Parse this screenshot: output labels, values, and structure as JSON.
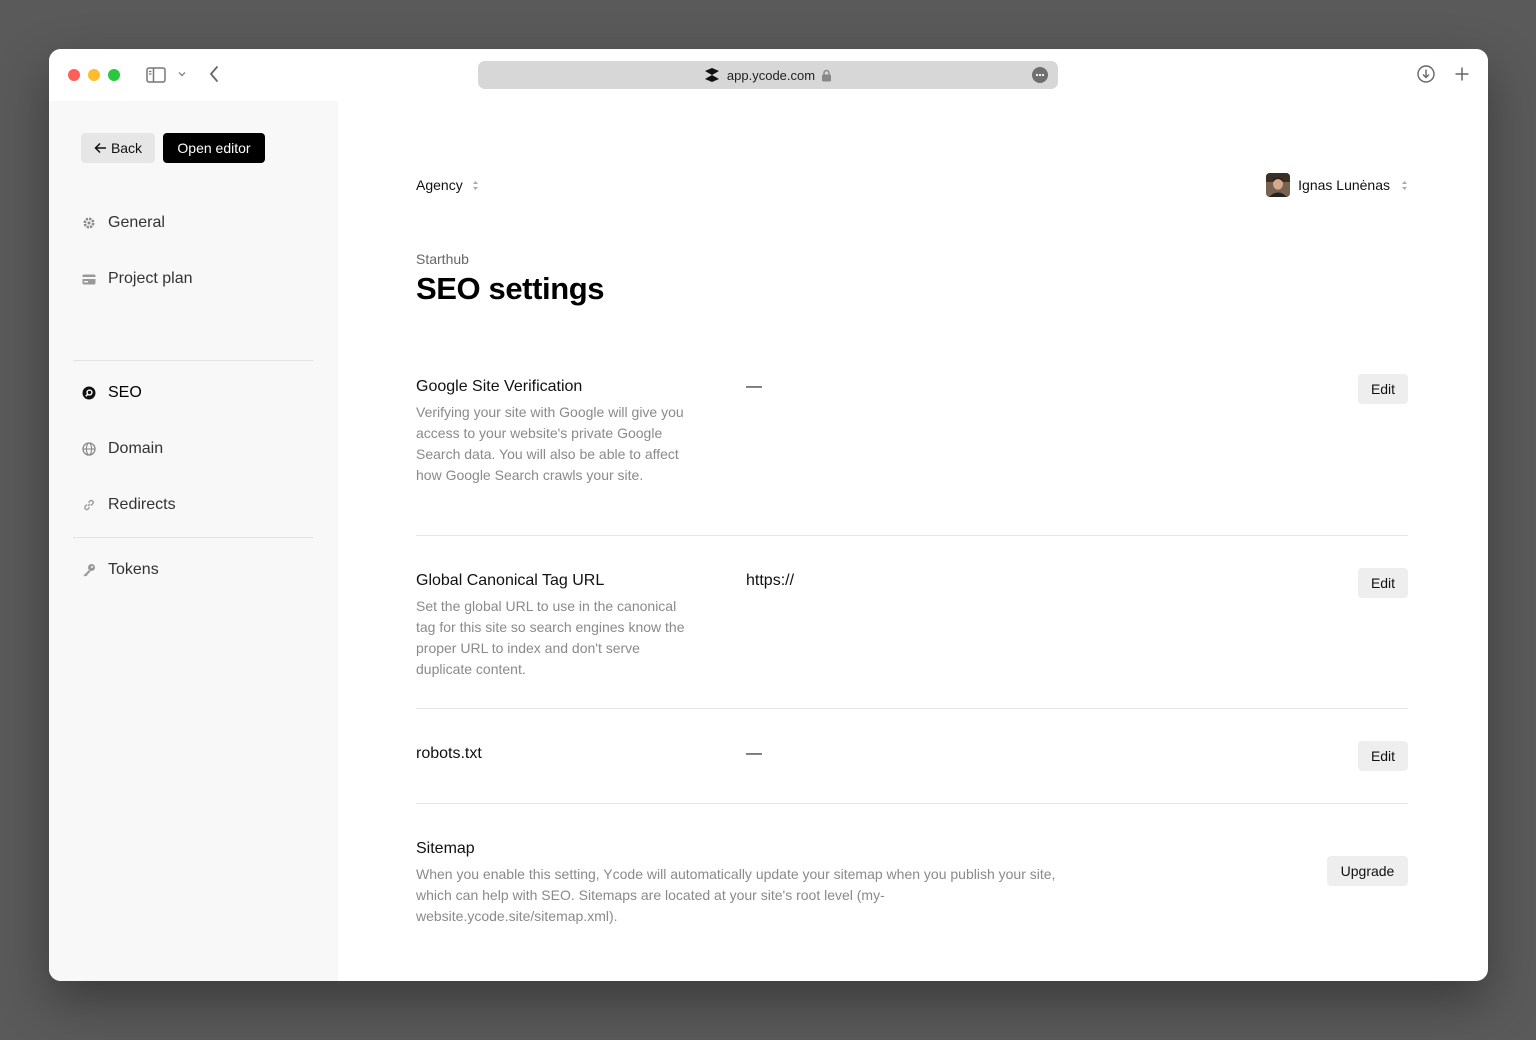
{
  "browser": {
    "url": "app.ycode.com"
  },
  "sidebar": {
    "back_label": "Back",
    "open_editor_label": "Open editor",
    "items": [
      {
        "label": "General",
        "icon": "gear-icon"
      },
      {
        "label": "Project plan",
        "icon": "card-icon"
      },
      {
        "label": "SEO",
        "icon": "seo-icon",
        "active": true
      },
      {
        "label": "Domain",
        "icon": "globe-icon"
      },
      {
        "label": "Redirects",
        "icon": "link-icon"
      },
      {
        "label": "Tokens",
        "icon": "key-icon"
      }
    ]
  },
  "header": {
    "workspace": "Agency",
    "user_name": "Ignas Lunėnas"
  },
  "page": {
    "breadcrumb": "Starthub",
    "title": "SEO settings"
  },
  "settings": [
    {
      "title": "Google Site Verification",
      "description": "Verifying your site with Google will give you access to your website's private Google Search data. You will also be able to affect how Google Search crawls your site.",
      "value": "—",
      "action": "Edit"
    },
    {
      "title": "Global Canonical Tag URL",
      "description": "Set the global URL to use in the canonical tag for this site so search engines know the proper URL to index and don't serve duplicate content.",
      "value": "https://",
      "action": "Edit"
    },
    {
      "title": "robots.txt",
      "description": "",
      "value": "—",
      "action": "Edit"
    },
    {
      "title": "Sitemap",
      "description": "When you enable this setting, Ycode will automatically update your sitemap when you publish your site, which can help with SEO. Sitemaps are located at your site's root level (my-website.ycode.site/sitemap.xml).",
      "value": "",
      "action": "Upgrade"
    }
  ],
  "colors": {
    "primary_button": "#000000",
    "secondary_button": "#eeeeee",
    "sidebar_bg": "#f8f8f8"
  }
}
